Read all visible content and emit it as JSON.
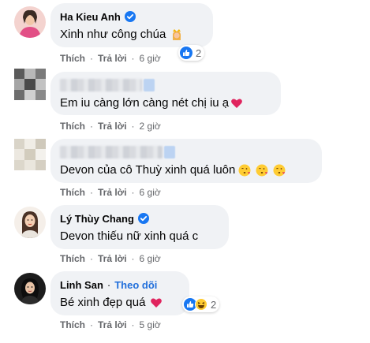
{
  "comments": [
    {
      "author": "Ha Kieu Anh",
      "verified": true,
      "text": "Xinh như công chúa",
      "emoji": "princess-emoji",
      "actions": {
        "like": "Thích",
        "reply": "Trả lời",
        "time": "6 giờ"
      },
      "reactions": {
        "icons": [
          "like-reaction"
        ],
        "count": "2"
      }
    },
    {
      "author": "",
      "author_blurred": true,
      "text": "Em iu càng lớn càng nét chị iu ạ",
      "emoji": "red-heart-emoji",
      "actions": {
        "like": "Thích",
        "reply": "Trả lời",
        "time": "2 giờ"
      }
    },
    {
      "author": "",
      "author_blurred": true,
      "text": "Devon của cô Thuỳ xinh quá luôn",
      "emoji": "face-blowing-kiss-emoji x3",
      "actions": {
        "like": "Thích",
        "reply": "Trả lời",
        "time": "6 giờ"
      }
    },
    {
      "author": "Lý Thùy Chang",
      "verified": true,
      "text": "Devon thiếu nữ xinh quá c",
      "actions": {
        "like": "Thích",
        "reply": "Trả lời",
        "time": "6 giờ"
      }
    },
    {
      "author": "Linh San",
      "separator": "·",
      "follow": "Theo dõi",
      "text": "Bé xinh đẹp quá",
      "emoji": "red-heart-emoji",
      "actions": {
        "like": "Thích",
        "reply": "Trả lời",
        "time": "5 giờ"
      },
      "reactions": {
        "icons": [
          "like-reaction",
          "haha-reaction"
        ],
        "count": "2"
      }
    }
  ],
  "colors": {
    "bubble": "#f0f2f5",
    "secondary_text": "#65676b",
    "link_blue": "#216fdb",
    "like_blue": "#1877f2",
    "heart_red": "#e0245e"
  }
}
